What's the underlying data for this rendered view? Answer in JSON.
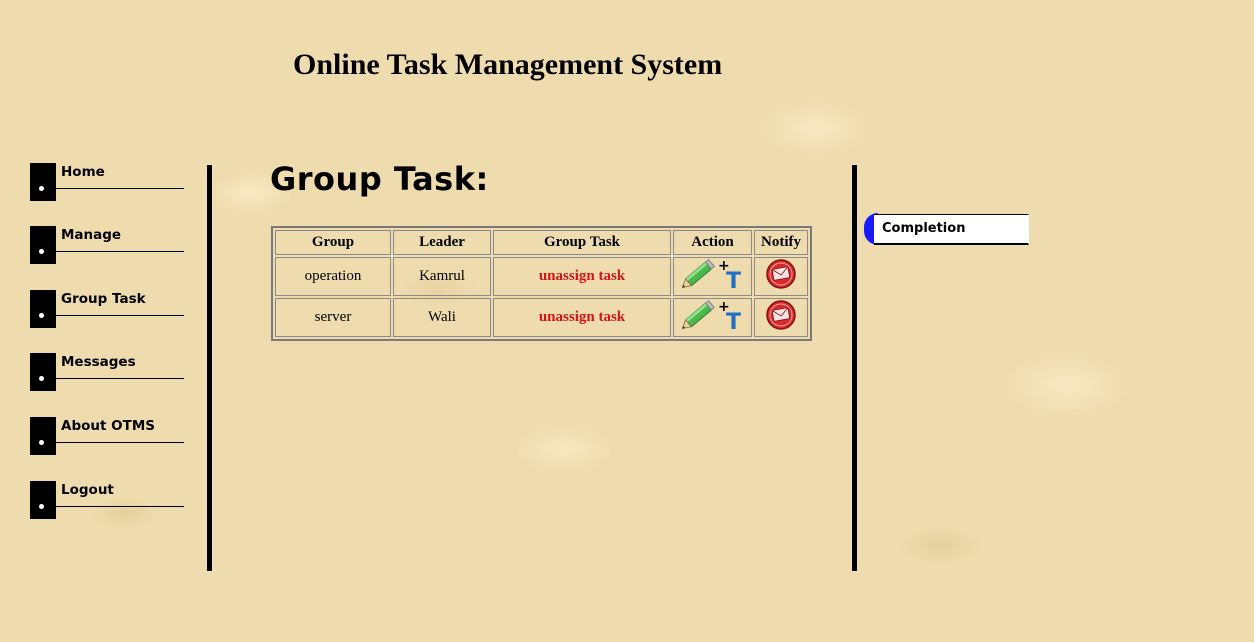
{
  "page": {
    "title": "Online Task Management System"
  },
  "nav": {
    "items": [
      {
        "label": "Home"
      },
      {
        "label": "Manage"
      },
      {
        "label": "Group Task"
      },
      {
        "label": "Messages"
      },
      {
        "label": "About OTMS"
      },
      {
        "label": "Logout"
      }
    ]
  },
  "main": {
    "heading": "Group Task:",
    "table": {
      "headers": [
        "Group",
        "Leader",
        "Group Task",
        "Action",
        "Notify"
      ],
      "rows": [
        {
          "group": "operation",
          "leader": "Kamrul",
          "task_link": "unassign task",
          "action_icon": "edit-add-task-icon",
          "notify_icon": "mail-notify-icon"
        },
        {
          "group": "server",
          "leader": "Wali",
          "task_link": "unassign task",
          "action_icon": "edit-add-task-icon",
          "notify_icon": "mail-notify-icon"
        }
      ]
    }
  },
  "right_panel": {
    "tab_label": "Completion"
  },
  "colors": {
    "link_red": "#d81414",
    "tab_blue": "#1a1aff",
    "background": "#efdcae"
  }
}
